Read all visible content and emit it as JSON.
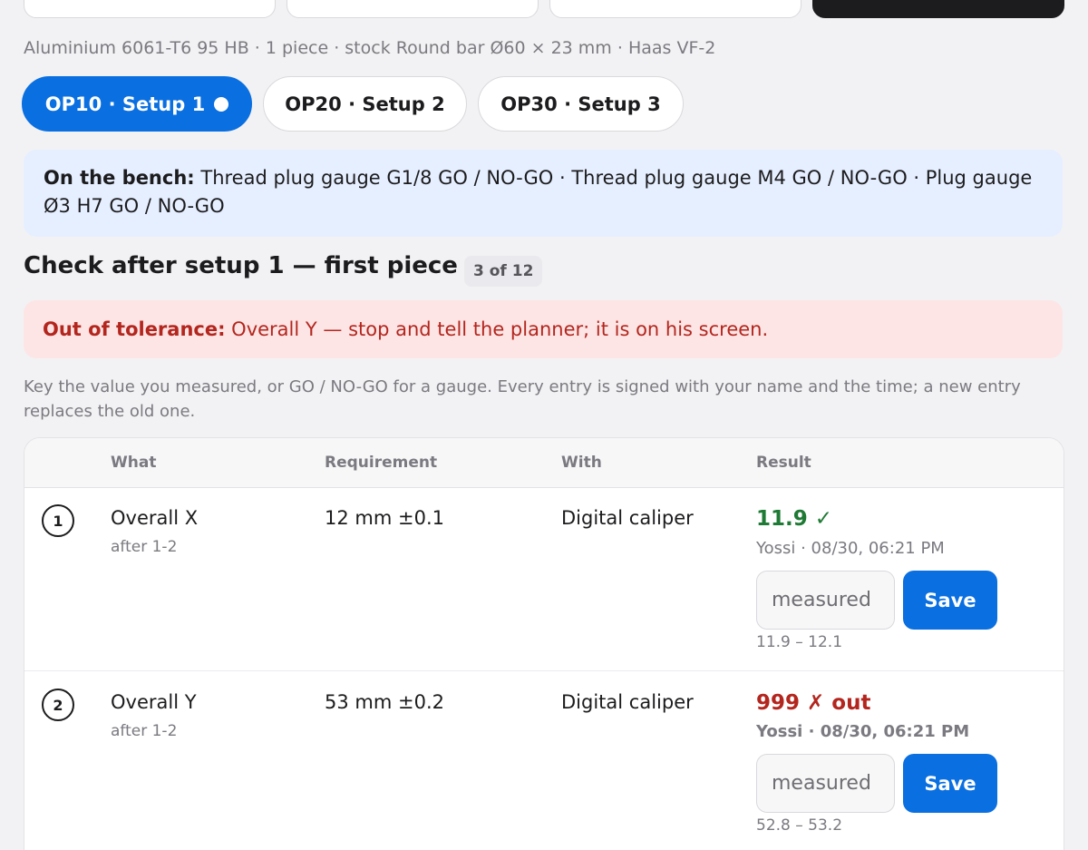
{
  "header": {
    "subline": "Aluminium 6061-T6 95 HB · 1 piece · stock Round bar Ø60 × 23 mm · Haas VF-2"
  },
  "tabs": [
    {
      "label": "OP10 · Setup 1",
      "active": true
    },
    {
      "label": "OP20 · Setup 2",
      "active": false
    },
    {
      "label": "OP30 · Setup 3",
      "active": false
    }
  ],
  "bench": {
    "label": "On the bench:",
    "text": " Thread plug gauge G1/8 GO / NO-GO · Thread plug gauge M4 GO / NO-GO · Plug gauge Ø3 H7 GO / NO-GO"
  },
  "section": {
    "title": "Check after setup 1 — first piece",
    "count": "3 of 12"
  },
  "alert": {
    "label": "Out of tolerance:",
    "text": " Overall Y — stop and tell the planner; it is on his screen."
  },
  "hint": "Key the value you measured, or GO / NO-GO for a gauge. Every entry is signed with your name and the time; a new entry replaces the old one.",
  "table": {
    "headers": {
      "what": "What",
      "requirement": "Requirement",
      "with": "With",
      "result": "Result"
    },
    "rows": [
      {
        "num": "1",
        "what": "Overall X",
        "after": "after 1-2",
        "requirement": "12 mm ±0.1",
        "with": "Digital caliper",
        "result": "11.9 ✓",
        "status": "ok",
        "signed": "Yossi · 08/30, 06:21 PM",
        "placeholder": "measured",
        "save": "Save",
        "range": "11.9 – 12.1"
      },
      {
        "num": "2",
        "what": "Overall Y",
        "after": "after 1-2",
        "requirement": "53 mm ±0.2",
        "with": "Digital caliper",
        "result": "999 ✗ out",
        "status": "bad",
        "signed": "Yossi · 08/30, 06:21 PM",
        "placeholder": "measured",
        "save": "Save",
        "range": "52.8 – 53.2"
      }
    ]
  },
  "colors": {
    "accent": "#0a6fe0",
    "ok": "#1e7a34",
    "error": "#b3261e",
    "bench_bg": "#e6efff",
    "alert_bg": "#fde5e5"
  }
}
